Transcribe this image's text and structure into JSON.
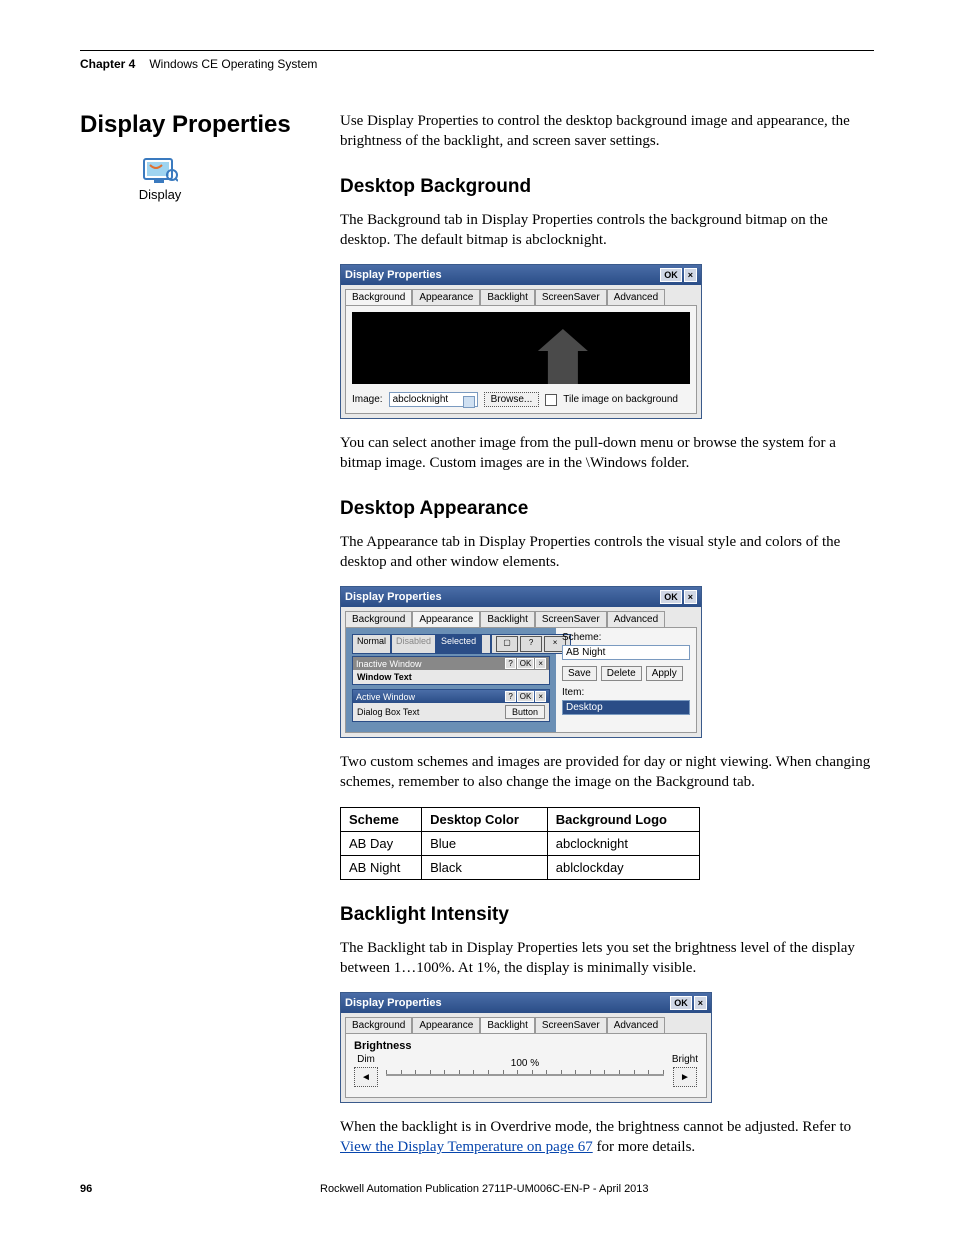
{
  "header": {
    "chapter": "Chapter 4",
    "title": "Windows CE Operating System"
  },
  "section_title": "Display Properties",
  "icon_caption": "Display",
  "intro": "Use Display Properties to control the desktop background image and appearance, the brightness of the backlight, and screen saver settings.",
  "bg": {
    "heading": "Desktop Background",
    "p1": "The Background tab in Display Properties controls the background bitmap on the desktop. The default bitmap is abclocknight.",
    "p2": "You can select another image from the pull-down menu or browse the system for a bitmap image. Custom images are in the \\Windows folder.",
    "dlg_title": "Display Properties",
    "tabs": [
      "Background",
      "Appearance",
      "Backlight",
      "ScreenSaver",
      "Advanced"
    ],
    "image_label": "Image:",
    "image_value": "abclocknight",
    "browse": "Browse...",
    "tile": "Tile image on background",
    "ok": "OK"
  },
  "ap": {
    "heading": "Desktop Appearance",
    "p1": "The Appearance tab in Display Properties controls the visual style and colors of the desktop and other window elements.",
    "p2": "Two custom schemes and images are provided for day or night viewing. When changing schemes, remember to also change the image on the Background tab.",
    "dlg_title": "Display Properties",
    "tabs": [
      "Background",
      "Appearance",
      "Backlight",
      "ScreenSaver",
      "Advanced"
    ],
    "scheme_label": "Scheme:",
    "scheme_value": "AB Night",
    "save": "Save",
    "delete": "Delete",
    "apply": "Apply",
    "item_label": "Item:",
    "item_value": "Desktop",
    "stub_tabs": [
      "Normal",
      "Disabled",
      "Selected"
    ],
    "inactive": "Inactive Window",
    "window_text": "Window Text",
    "active": "Active Window",
    "dialog_text": "Dialog Box Text",
    "button": "Button",
    "ok": "OK",
    "q": "?",
    "x": "×",
    "table": {
      "headers": [
        "Scheme",
        "Desktop Color",
        "Background Logo"
      ],
      "rows": [
        [
          "AB Day",
          "Blue",
          "abclocknight"
        ],
        [
          "AB Night",
          "Black",
          "ablclockday"
        ]
      ]
    }
  },
  "bl": {
    "heading": "Backlight Intensity",
    "p1": "The Backlight tab in Display Properties lets you set the brightness level of the display between 1…100%. At 1%, the display is minimally visible.",
    "p2a": "When the backlight is in Overdrive mode, the brightness cannot be adjusted. Refer to ",
    "link": "View the Display Temperature on page 67",
    "p2b": " for more details.",
    "dlg_title": "Display Properties",
    "tabs": [
      "Background",
      "Appearance",
      "Backlight",
      "ScreenSaver",
      "Advanced"
    ],
    "brightness": "Brightness",
    "dim": "Dim",
    "bright": "Bright",
    "pct": "100 %",
    "ok": "OK"
  },
  "footer": {
    "page": "96",
    "pub": "Rockwell Automation Publication 2711P-UM006C-EN-P - April 2013"
  }
}
